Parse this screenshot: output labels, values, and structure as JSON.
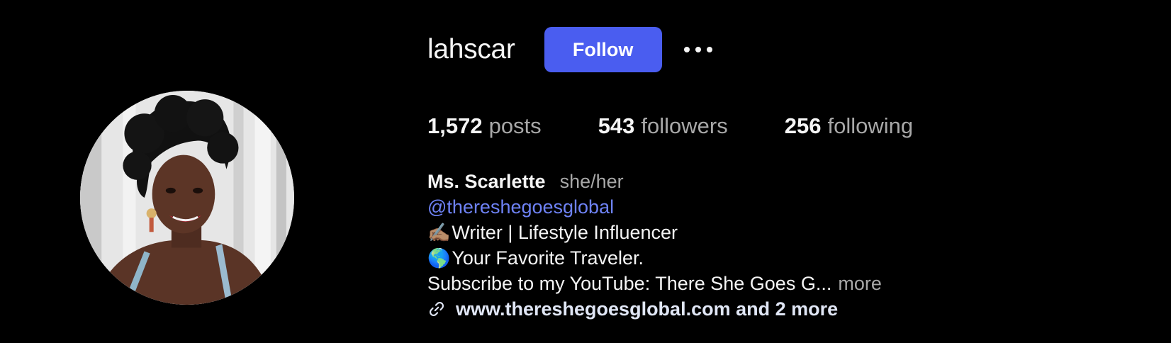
{
  "profile": {
    "username": "lahscar",
    "follow_label": "Follow",
    "more_options_icon": "more-horizontal-icon",
    "accent_color": "#4a5df0"
  },
  "stats": {
    "posts_count": "1,572",
    "posts_label": "posts",
    "followers_count": "543",
    "followers_label": "followers",
    "following_count": "256",
    "following_label": "following"
  },
  "bio": {
    "full_name": "Ms. Scarlette",
    "pronouns": "she/her",
    "mention": "@thereshegoesglobal",
    "line1_emoji": "✍🏽",
    "line1_text": "Writer | Lifestyle Influencer",
    "line2_emoji": "🌎",
    "line2_text": "Your Favorite Traveler.",
    "line3_text": "Subscribe to my YouTube: There She Goes G...",
    "more_label": "more",
    "link_icon": "link-icon",
    "website": "www.thereshegoesglobal.com and 2 more",
    "mention_color": "#6e82f5"
  }
}
